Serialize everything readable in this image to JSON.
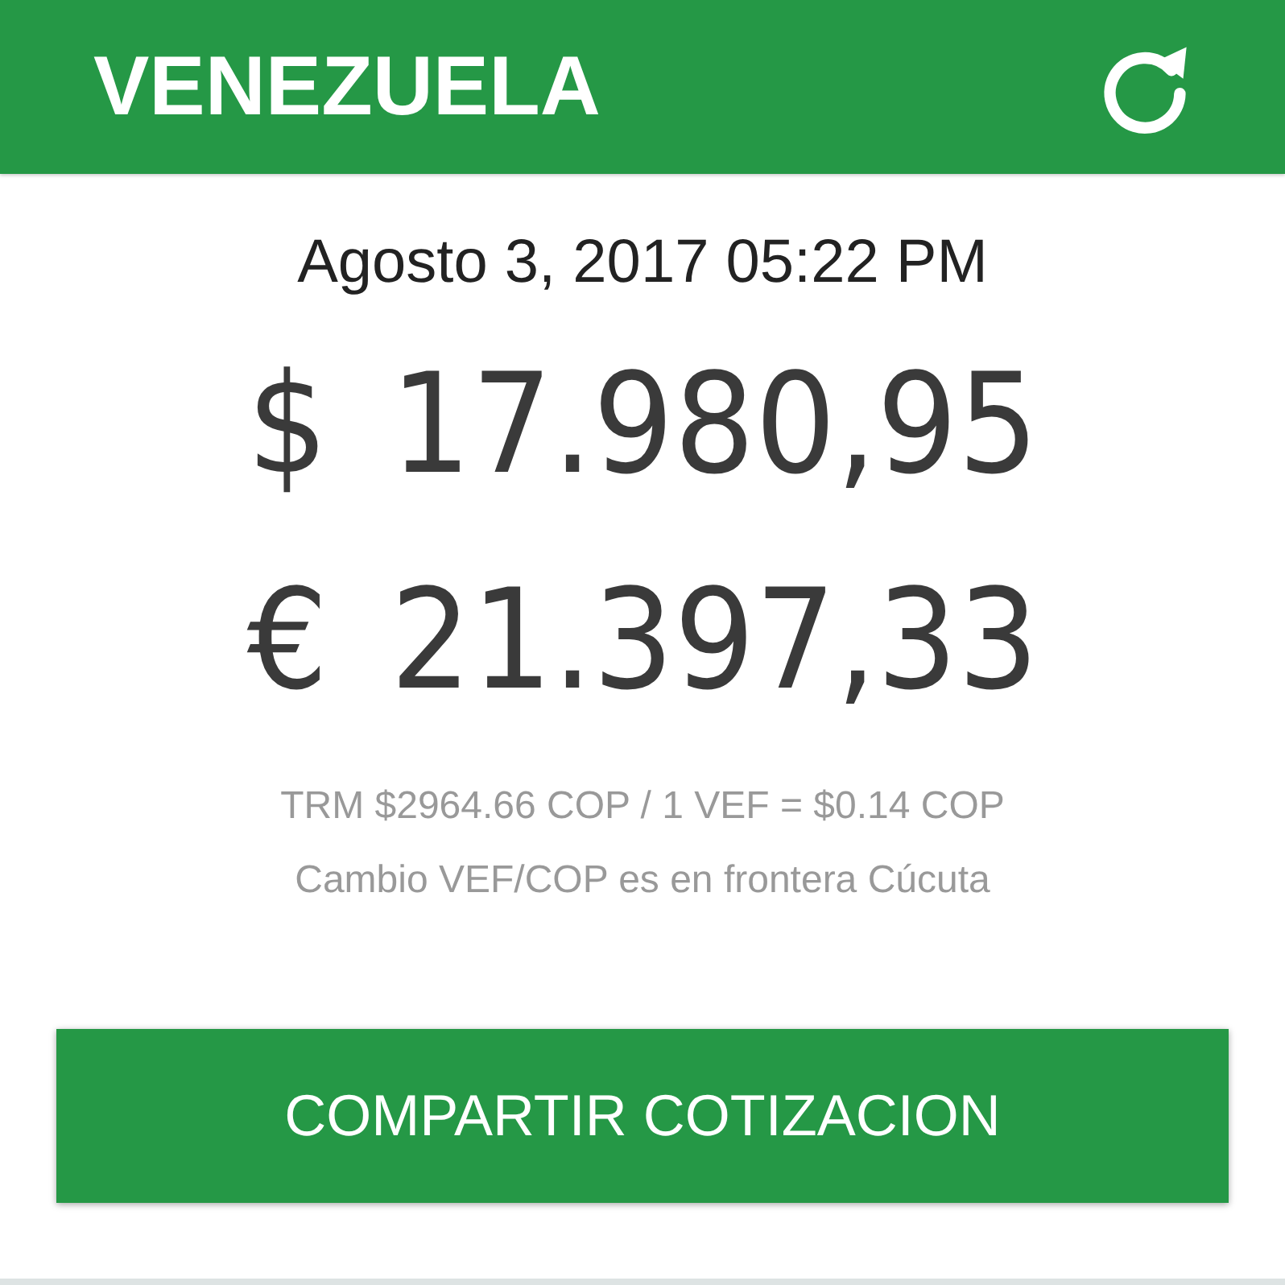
{
  "header": {
    "title": "VENEZUELA"
  },
  "date": "Agosto 3, 2017 05:22 PM",
  "rates": [
    {
      "symbol": "$",
      "amount": "17.980,95"
    },
    {
      "symbol": "€",
      "amount": "21.397,33"
    }
  ],
  "notes": [
    "TRM $2964.66 COP / 1 VEF = $0.14 COP",
    "Cambio VEF/COP es en frontera Cúcuta"
  ],
  "share_button": "COMPARTIR COTIZACION"
}
